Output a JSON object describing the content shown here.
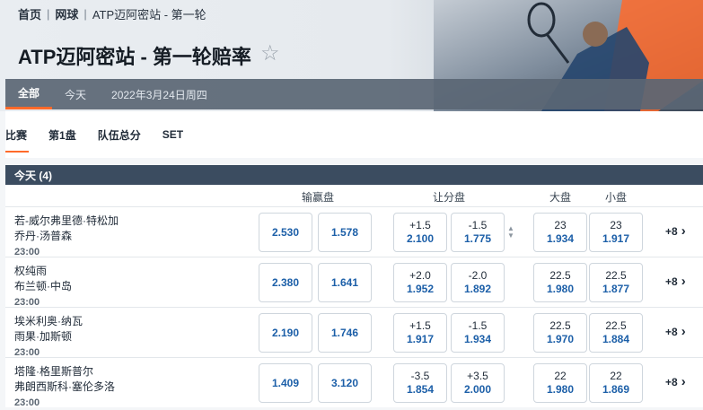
{
  "breadcrumb": {
    "home": "首页",
    "sport": "网球",
    "current": "ATP迈阿密站 - 第一轮"
  },
  "page": {
    "title": "ATP迈阿密站 - 第一轮赔率",
    "favorite_icon": "star-icon"
  },
  "date_tabs": [
    "全部",
    "今天",
    "2022年3月24日周四"
  ],
  "market_tabs": [
    "比赛",
    "第1盘",
    "队伍总分",
    "SET"
  ],
  "group": {
    "title": "今天 (4)"
  },
  "columns": {
    "moneyline": "输赢盘",
    "handicap": "让分盘",
    "over": "大盘",
    "under": "小盘"
  },
  "colors": {
    "accent": "#ff6a2a",
    "odds": "#1c5fa8",
    "header": "#3b4c60"
  },
  "matches": [
    {
      "team1": "若-威尔弗里德·特松加",
      "team2": "乔丹·汤普森",
      "time": "23:00",
      "ml1": "2.530",
      "ml2": "1.578",
      "hcp1_line": "+1.5",
      "hcp1_price": "2.100",
      "hcp2_line": "-1.5",
      "hcp2_price": "1.775",
      "over_line": "23",
      "over_price": "1.934",
      "under_line": "23",
      "under_price": "1.917",
      "more": "+8"
    },
    {
      "team1": "权纯雨",
      "team2": "布兰顿·中岛",
      "time": "23:00",
      "ml1": "2.380",
      "ml2": "1.641",
      "hcp1_line": "+2.0",
      "hcp1_price": "1.952",
      "hcp2_line": "-2.0",
      "hcp2_price": "1.892",
      "over_line": "22.5",
      "over_price": "1.980",
      "under_line": "22.5",
      "under_price": "1.877",
      "more": "+8"
    },
    {
      "team1": "埃米利奥·纳瓦",
      "team2": "雨果·加斯顿",
      "time": "23:00",
      "ml1": "2.190",
      "ml2": "1.746",
      "hcp1_line": "+1.5",
      "hcp1_price": "1.917",
      "hcp2_line": "-1.5",
      "hcp2_price": "1.934",
      "over_line": "22.5",
      "over_price": "1.970",
      "under_line": "22.5",
      "under_price": "1.884",
      "more": "+8"
    },
    {
      "team1": "塔隆·格里斯普尔",
      "team2": "弗朗西斯科·塞伦多洛",
      "time": "23:00",
      "ml1": "1.409",
      "ml2": "3.120",
      "hcp1_line": "-3.5",
      "hcp1_price": "1.854",
      "hcp2_line": "+3.5",
      "hcp2_price": "2.000",
      "over_line": "22",
      "over_price": "1.980",
      "under_line": "22",
      "under_price": "1.869",
      "more": "+8"
    }
  ]
}
